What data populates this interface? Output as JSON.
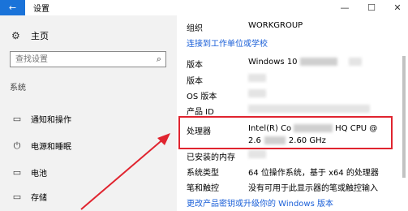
{
  "window": {
    "title": "设置",
    "back_glyph": "←",
    "minimize_glyph": "—",
    "maximize_glyph": "☐",
    "close_glyph": "✕"
  },
  "sidebar": {
    "home_label": "主页",
    "search_placeholder": "查找设置",
    "section_label": "系统",
    "items": [
      {
        "label": "通知和操作",
        "icon": "notification-icon",
        "glyph": "▭"
      },
      {
        "label": "电源和睡眠",
        "icon": "power-icon",
        "glyph": "⏻"
      },
      {
        "label": "电池",
        "icon": "battery-icon",
        "glyph": "▭"
      },
      {
        "label": "存储",
        "icon": "storage-icon",
        "glyph": "▭"
      }
    ]
  },
  "content": {
    "org_label": "组织",
    "org_value": "WORKGROUP",
    "join_link": "连接到工作单位或学校",
    "edition_label": "版本",
    "edition_value": "Windows 10 ",
    "version_label": "版本",
    "os_build_label": "OS 版本",
    "product_id_label": "产品 ID",
    "processor_label": "处理器",
    "processor_line1_a": "Intel(R) Co",
    "processor_line1_b": "HQ CPU @",
    "processor_line2_a": "2.6",
    "processor_line2_b": "2.60 GHz",
    "ram_label": "已安装的内存",
    "system_type_label": "系统类型",
    "system_type_value": "64 位操作系统，基于 x64 的处理器",
    "pen_touch_label": "笔和触控",
    "pen_touch_value": "没有可用于此显示器的笔或触控输入",
    "change_key_link": "更改产品密钥或升级你的 Windows 版本"
  },
  "colors": {
    "accent": "#1a73d9",
    "link": "#1a5fd8",
    "highlight": "#e0242f",
    "sidebar_bg": "#f2f2f2"
  }
}
